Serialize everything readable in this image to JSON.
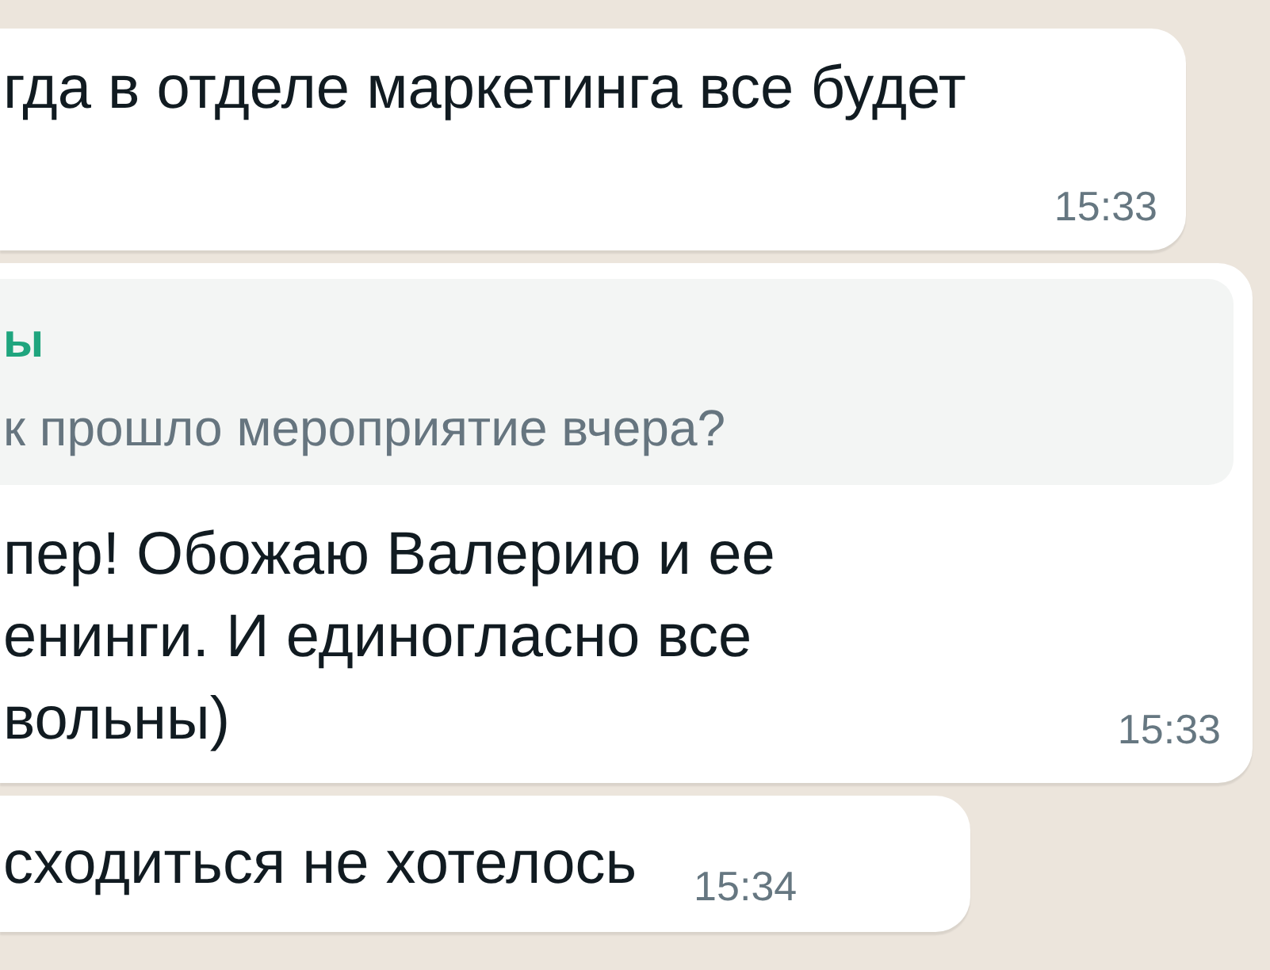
{
  "messages": [
    {
      "kind": "text",
      "lines": [
        "гда в отделе маркетинга все будет"
      ],
      "time": "15:33"
    },
    {
      "kind": "reply",
      "quote": {
        "sender": "ы",
        "text": "к прошло мероприятие вчера?"
      },
      "lines": [
        "пер! Обожаю Валерию и ее",
        "енинги. И единогласно все",
        "вольны)"
      ],
      "time": "15:33"
    },
    {
      "kind": "inline",
      "lines": [
        "сходиться не хотелось"
      ],
      "time": "15:34"
    }
  ]
}
